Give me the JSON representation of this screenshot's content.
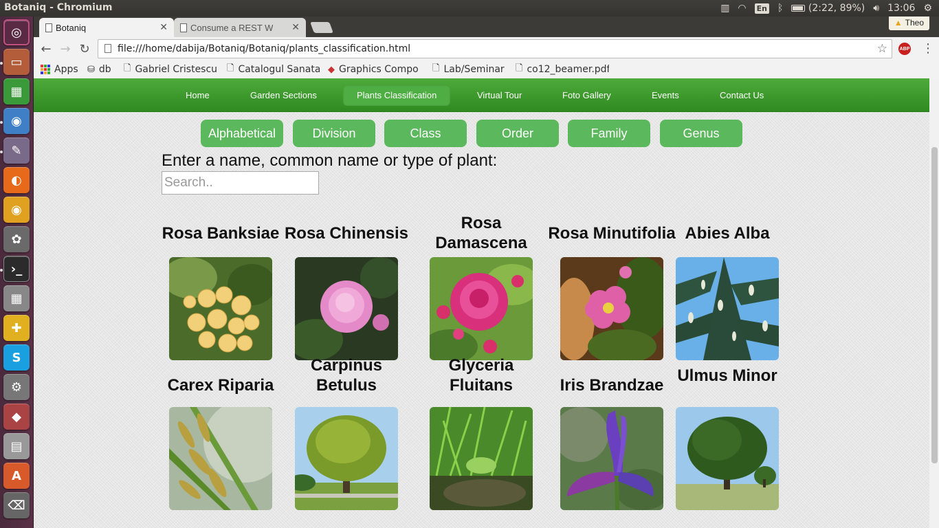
{
  "window": {
    "title": "Botaniq - Chromium"
  },
  "system_tray": {
    "battery": "(2:22, 89%)",
    "time": "13:06",
    "language": "En"
  },
  "browser": {
    "tabs": [
      {
        "title": "Botaniq",
        "active": true
      },
      {
        "title": "Consume a REST W",
        "active": false
      }
    ],
    "profile": "Theo",
    "url": "file:///home/dabija/Botaniq/Botaniq/plants_classification.html",
    "bookmarks": [
      "Apps",
      "db",
      "Gabriel Cristescu",
      "Catalogul Sanata",
      "Graphics Compo",
      "Lab/Seminar",
      "co12_beamer.pdf"
    ],
    "adblock_label": "ABP"
  },
  "site_nav": {
    "items": [
      "Home",
      "Garden Sections",
      "Plants Classification",
      "Virtual Tour",
      "Foto Gallery",
      "Events",
      "Contact Us"
    ],
    "active": "Plants Classification"
  },
  "filters": [
    "Alphabetical",
    "Division",
    "Class",
    "Order",
    "Family",
    "Genus"
  ],
  "search": {
    "label": "Enter a name, common name or type of plant:",
    "placeholder": "Search..",
    "value": ""
  },
  "plants": [
    {
      "name": "Rosa Banksiae"
    },
    {
      "name": "Rosa Chinensis"
    },
    {
      "name": "Rosa Damascena"
    },
    {
      "name": "Rosa Minutifolia"
    },
    {
      "name": "Abies Alba"
    },
    {
      "name": "Carex Riparia"
    },
    {
      "name": "Carpinus Betulus"
    },
    {
      "name": "Glyceria Fluitans"
    },
    {
      "name": "Iris Brandzae"
    },
    {
      "name": "Ulmus Minor"
    }
  ],
  "colors": {
    "nav_green": "#3a9a2c",
    "button_green": "#5cb85c",
    "launcher": "#5a3146"
  },
  "launcher_icons": [
    "ubuntu-dash-icon",
    "files-icon",
    "spreadsheet-icon",
    "chromium-icon",
    "text-editor-icon",
    "firefox-icon",
    "chrome-icon",
    "gimp-icon",
    "terminal-icon",
    "calculator-icon",
    "puzzle-icon",
    "skype-icon",
    "settings-icon",
    "app-icon",
    "disk-icon",
    "trash-icon"
  ]
}
